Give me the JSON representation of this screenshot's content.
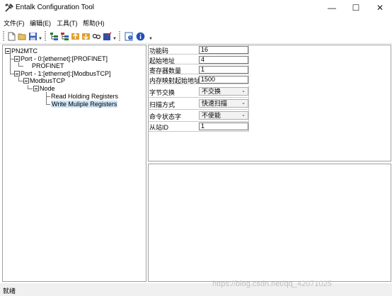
{
  "window": {
    "title": "Entalk Configuration Tool",
    "controls": {
      "minimize": "—",
      "maximize": "☐",
      "close": "✕"
    }
  },
  "menu": [
    "文件(F)",
    "编辑(E)",
    "工具(T)",
    "帮助(H)"
  ],
  "toolbar_icons": [
    "new-file-icon",
    "open-folder-icon",
    "save-icon",
    "tree-view-icon",
    "tree-edit-icon",
    "upload-icon",
    "download-icon",
    "link-icon",
    "export-icon",
    "config-icon",
    "info-icon"
  ],
  "tree": {
    "root": "PN2MTC",
    "port0": "Port - 0:[ethernet]:[PROFINET]",
    "profinet": "PROFINET",
    "port1": "Port - 1:[ethernet]:[ModbusTCP]",
    "modbus": "ModbusTCP",
    "node": "Node",
    "read": "Read Holding Registers",
    "write": "Write Muliple Registers"
  },
  "properties": [
    {
      "label": "功能码",
      "value": "16"
    },
    {
      "label": "起始地址",
      "value": "4"
    },
    {
      "label": "寄存器数量",
      "value": "1"
    },
    {
      "label": "内存映射起始地址",
      "value": "1500"
    },
    {
      "label": "字节交换",
      "value": "不交换"
    },
    {
      "label": "扫描方式",
      "value": "快速扫描"
    },
    {
      "label": "命令状态字",
      "value": "不使能"
    },
    {
      "label": "从站ID",
      "value": "1"
    }
  ],
  "status": "就绪",
  "watermark": "https://blog.csdn.net/qq_42071025"
}
